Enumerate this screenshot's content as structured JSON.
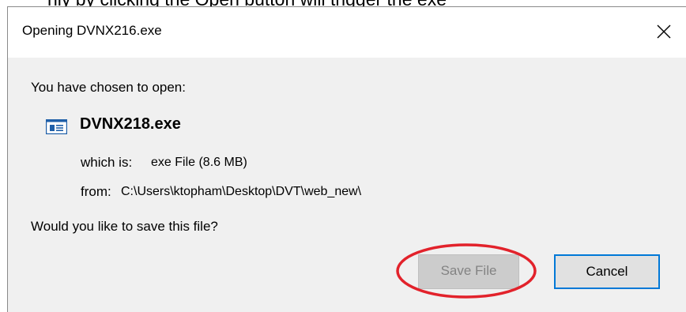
{
  "context": {
    "above_text": "nly by clicking the Open button will trigger the exe"
  },
  "dialog": {
    "title": "Opening DVNX216.exe",
    "close_symbol": "✕",
    "intro": "You have chosen to open:",
    "file": {
      "icon": "exe-file-icon",
      "name": "DVNX218.exe",
      "which_is_label": "which is:",
      "which_is_value": "exe File (8.6 MB)",
      "from_label": "from:",
      "from_value": "C:\\Users\\ktopham\\Desktop\\DVT\\web_new\\"
    },
    "question": "Would you like to save this file?",
    "buttons": {
      "save": "Save File",
      "cancel": "Cancel"
    }
  },
  "colors": {
    "dialog_background": "#f0f0f0",
    "titlebar_background": "#ffffff",
    "focus_border": "#0078d7",
    "annotation": "#e2222b"
  }
}
